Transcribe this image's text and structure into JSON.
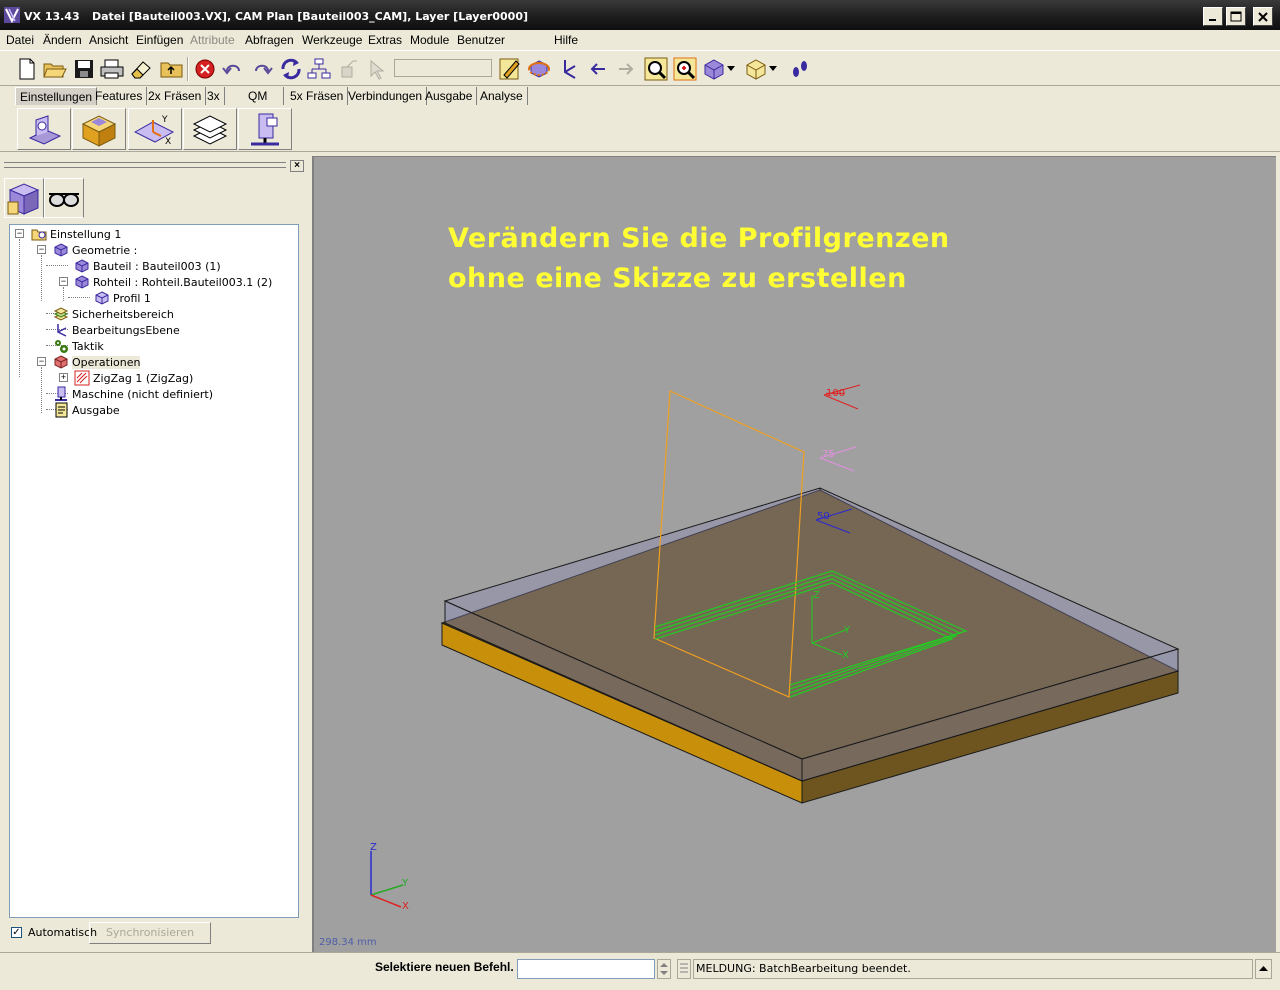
{
  "window": {
    "app_version": "VX  13.43",
    "title": "Datei [Bauteil003.VX],  CAM Plan [Bauteil003_CAM],  Layer [Layer0000]"
  },
  "menu": {
    "items": [
      "Datei",
      "Ändern",
      "Ansicht",
      "Einfügen",
      "Attribute",
      "Abfragen",
      "Werkzeuge",
      "Extras",
      "Module",
      "Benutzer",
      "Hilfe"
    ]
  },
  "tabs": [
    "Einstellungen",
    "Features",
    "2x Fräsen",
    "3x",
    "QM",
    "5x Fräsen",
    "Verbindungen",
    "Ausgabe",
    "Analyse"
  ],
  "tree": {
    "nodes": [
      "Einstellung 1",
      "Geometrie :",
      "Bauteil : Bauteil003 (1)",
      "Rohteil : Rohteil.Bauteil003.1 (2)",
      "Profil 1",
      "Sicherheitsbereich",
      "BearbeitungsEbene",
      "Taktik",
      "Operationen",
      "ZigZag 1 (ZigZag)",
      "Maschine (nicht definiert)",
      "Ausgabe"
    ]
  },
  "panel": {
    "auto_label": "Automatisch",
    "sync_label": "Synchronisieren"
  },
  "viewport": {
    "title_line1": "Verändern Sie die Profilgrenzen",
    "title_line2": "ohne eine Skizze zu erstellen",
    "label_100": "100",
    "label_75": "75",
    "label_50": "50",
    "axis_z": "Z",
    "axis_y": "Y",
    "axis_x": "X",
    "dimension": "298.34 mm"
  },
  "status": {
    "command_label": "Selektiere neuen Befehl.",
    "message": "MELDUNG: BatchBearbeitung beendet."
  }
}
